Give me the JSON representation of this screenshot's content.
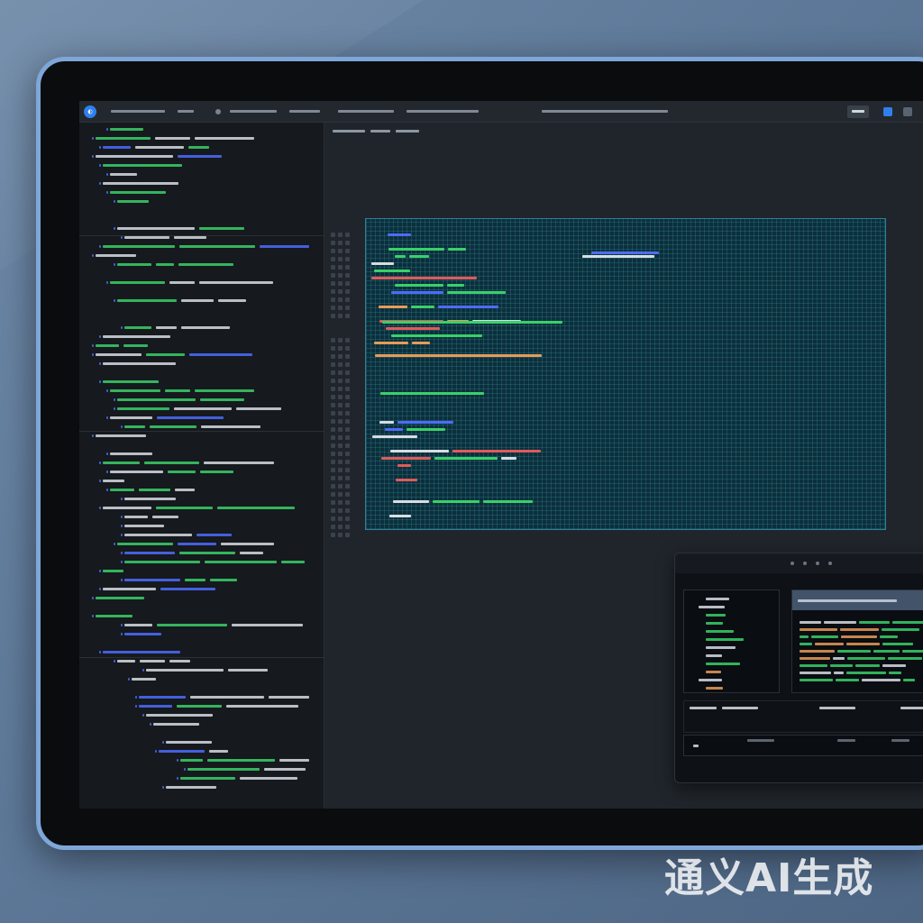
{
  "watermark": "通义AI生成",
  "colors": {
    "accent": "#2f80ed",
    "code_green": "#3ad06a",
    "code_blue": "#4c6cff",
    "code_white": "#d7dde4",
    "code_orange": "#e79b57",
    "code_red": "#e05a5a",
    "canvas_bg": "#0c2f3b"
  },
  "icons": {
    "app_logo": "app-logo-icon",
    "layout": "layout-icon",
    "grid": "grid-icon"
  }
}
